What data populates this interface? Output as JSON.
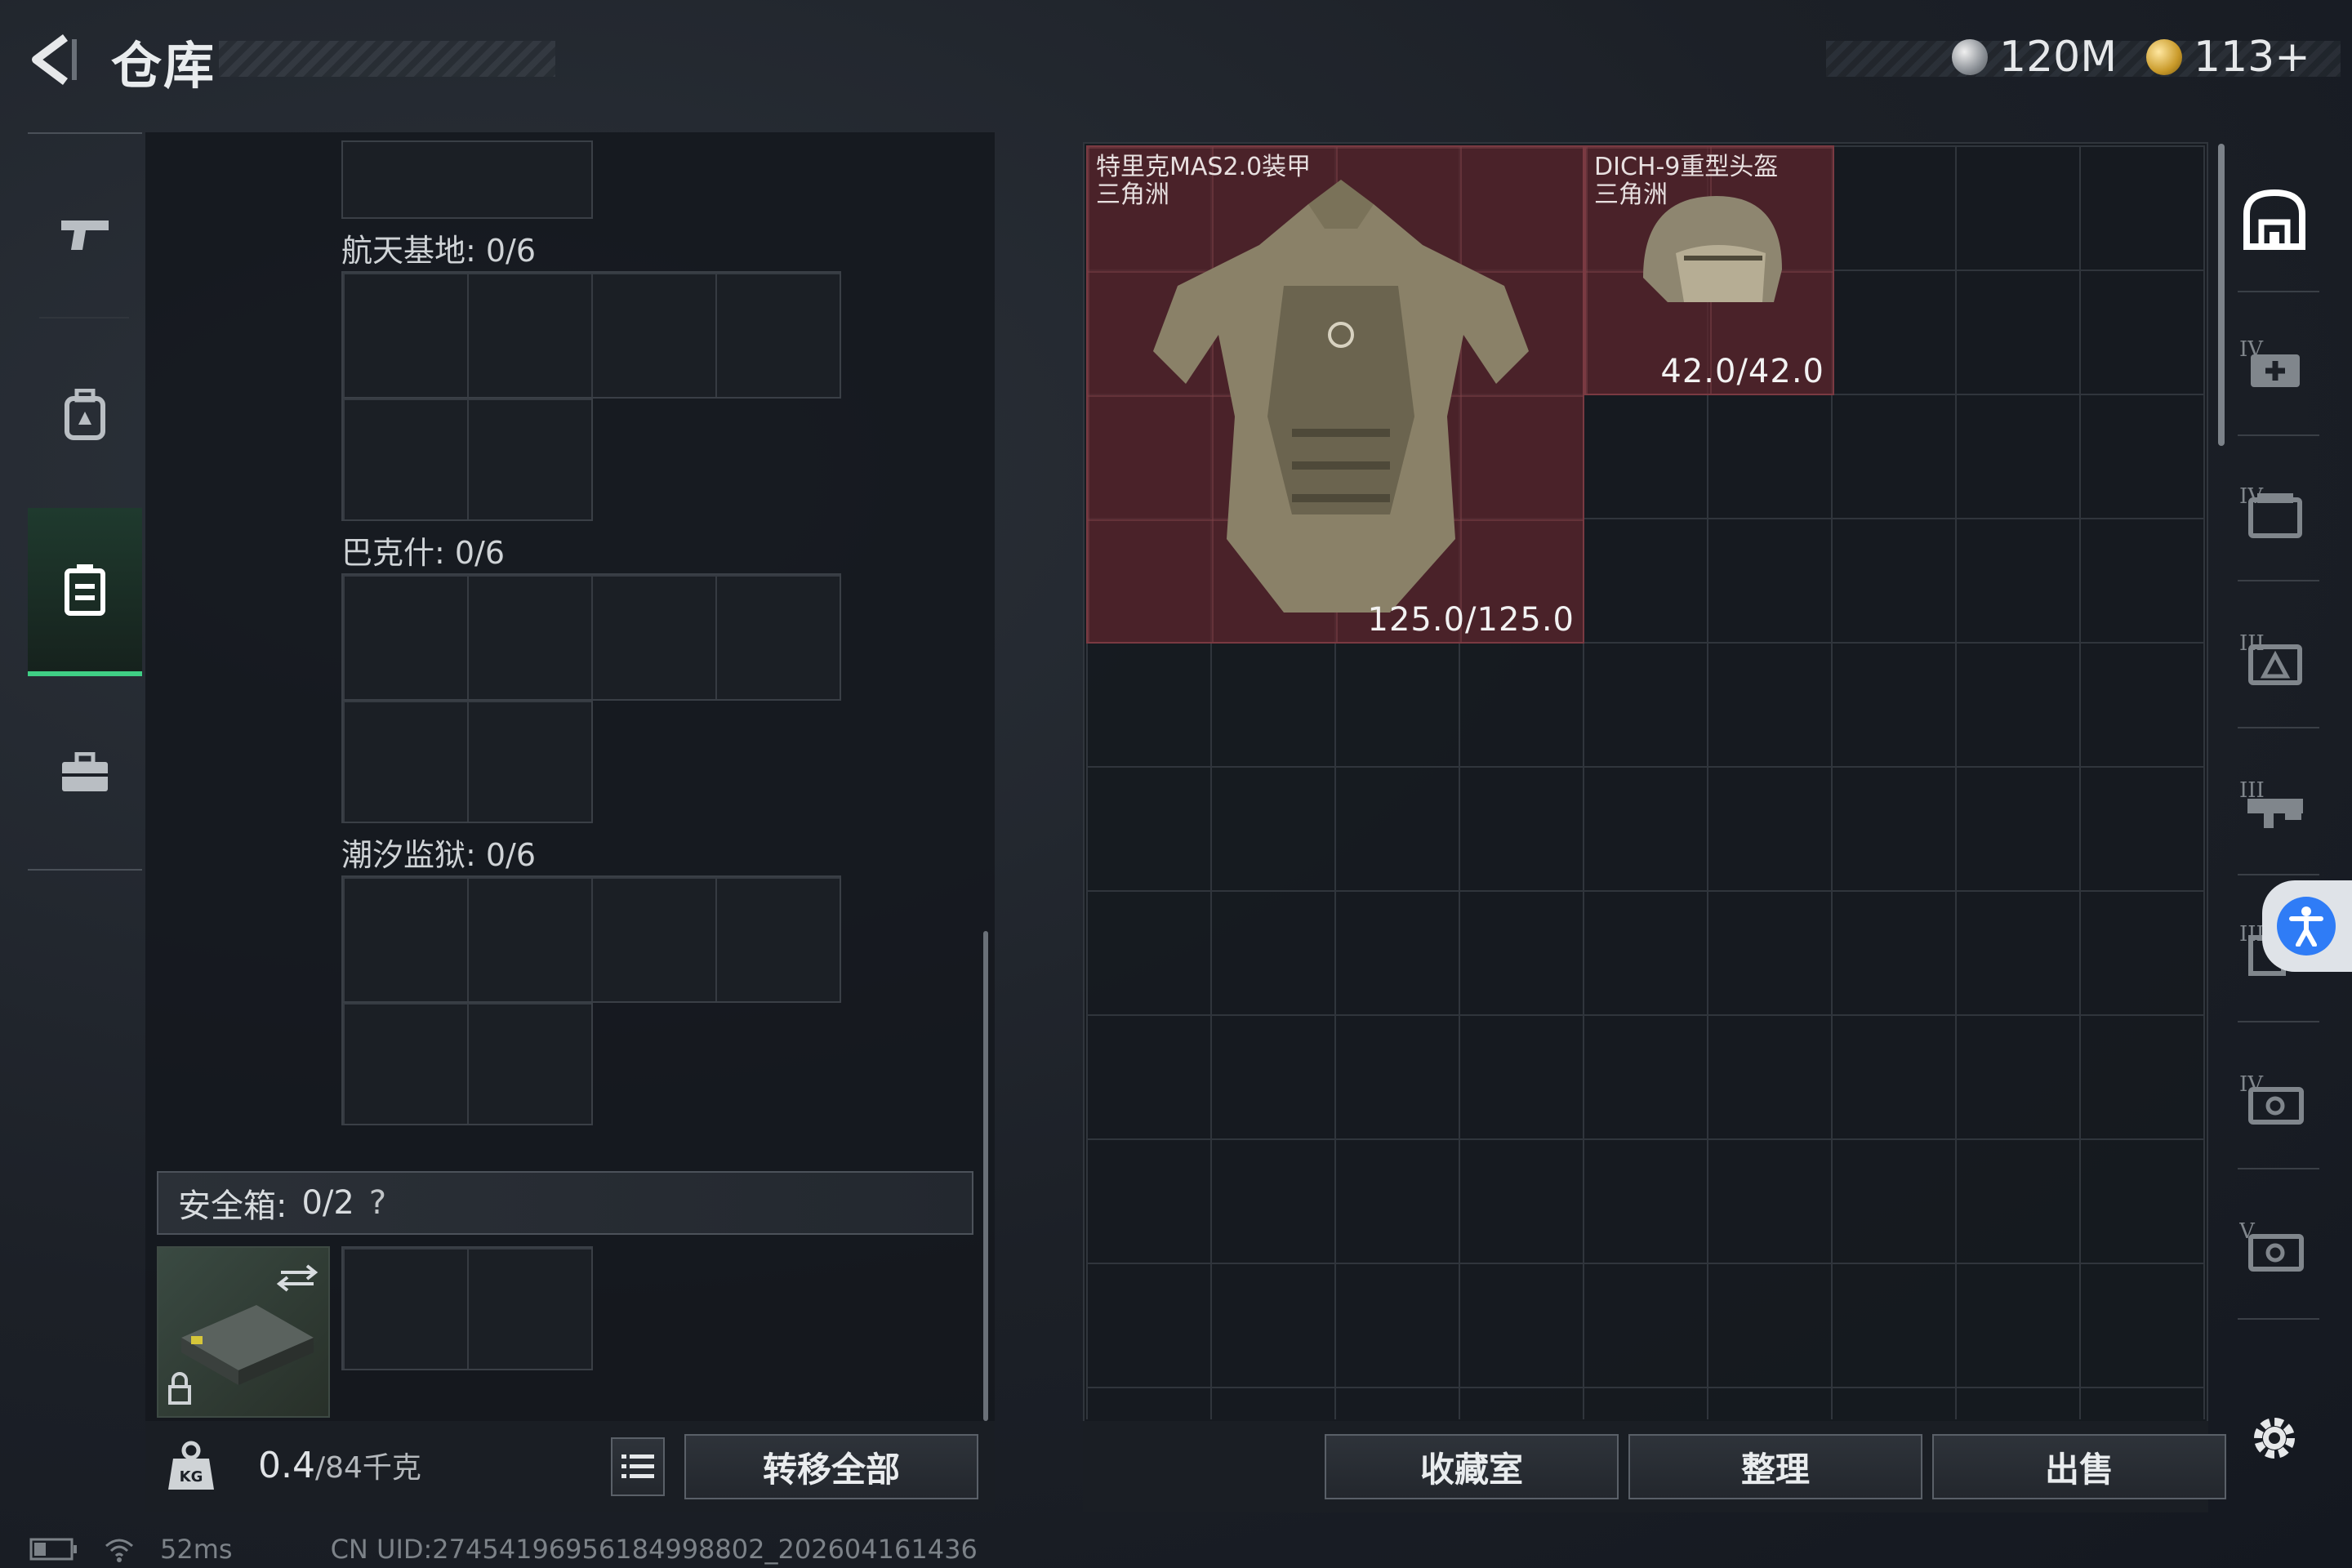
{
  "header": {
    "title": "仓库",
    "currency_1": "120M",
    "currency_2": "113+"
  },
  "left_nav": {
    "items": [
      "weapon-icon",
      "backpack-icon",
      "rig-icon",
      "toolbox-icon"
    ],
    "active_index": 2
  },
  "map_containers": [
    {
      "label": "航天基地: 0/6"
    },
    {
      "label": "巴克什: 0/6"
    },
    {
      "label": "潮汐监狱: 0/6"
    }
  ],
  "safebox": {
    "label": "安全箱:",
    "count": "0/2",
    "help": "?"
  },
  "footer_left": {
    "weight_value": "0.4",
    "weight_max": "/84千克",
    "transfer_all": "转移全部"
  },
  "stash_items": [
    {
      "name": "特里克MAS2.0装甲",
      "sub": "三角洲",
      "durability": "125.0/125.0"
    },
    {
      "name": "DICH-9重型头盔",
      "sub": "三角洲",
      "durability": "42.0/42.0"
    }
  ],
  "footer_right": {
    "collection_room": "收藏室",
    "organize": "整理",
    "sell": "出售"
  },
  "right_sidebar": {
    "items": [
      "home-stash-icon",
      "medical-case-icon",
      "document-case-icon",
      "ammo-case-icon",
      "weapon-case-icon",
      "misc-case-icon",
      "keycard-case-icon",
      "key-case-icon"
    ],
    "tier_labels": [
      "IV",
      "IV",
      "III",
      "III",
      "III",
      "IV",
      "V"
    ]
  },
  "status_bar": {
    "ping": "52ms",
    "uid": "CN UID:27454196956184998802_202604161436"
  },
  "colors": {
    "active_accent": "#3fcf85",
    "item_bg": "#5c262c",
    "access_blue": "#2f7cf6"
  }
}
